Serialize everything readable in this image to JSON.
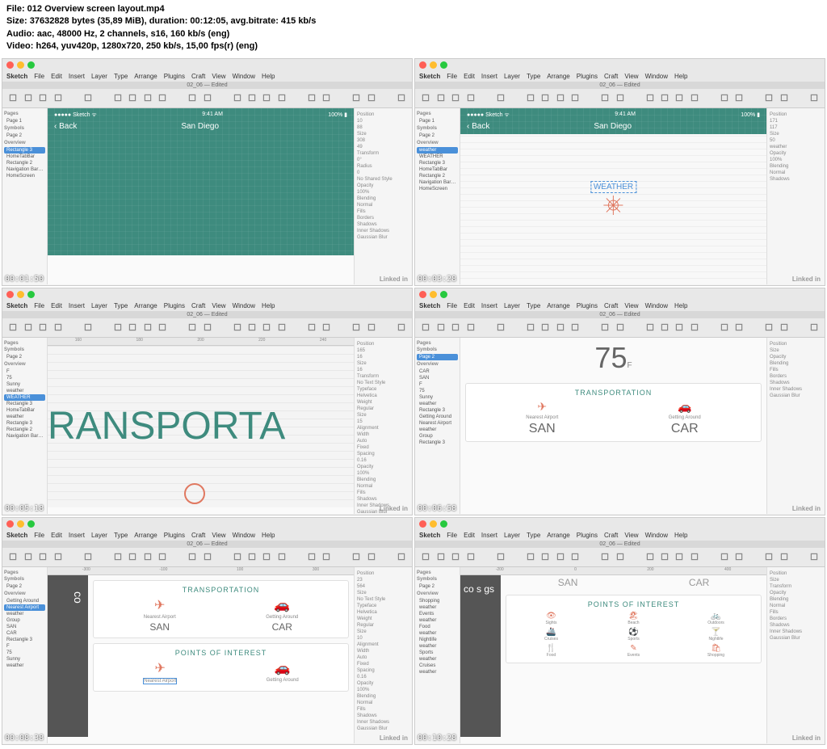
{
  "meta": {
    "file": "File: 012 Overview screen layout.mp4",
    "size": "Size: 37632828 bytes (35,89 MiB), duration: 00:12:05, avg.bitrate: 415 kb/s",
    "audio": "Audio: aac, 48000 Hz, 2 channels, s16, 160 kb/s (eng)",
    "video": "Video: h264, yuv420p, 1280x720, 250 kb/s, 15,00 fps(r) (eng)"
  },
  "menus": [
    "Sketch",
    "File",
    "Edit",
    "Insert",
    "Layer",
    "Type",
    "Arrange",
    "Plugins",
    "Craft",
    "View",
    "Window",
    "Help"
  ],
  "tabname": "02_06 — Edited",
  "linkedin": "Linked in",
  "phone": {
    "carrier": "Sketch",
    "time": "9:41 AM",
    "batt": "100%",
    "back": "Back",
    "title": "San Diego"
  },
  "tiles": [
    {
      "ts": "00:01:50",
      "left_sel": "Rectangle 3",
      "left": [
        "Pages",
        "Page 1",
        "Symbols",
        "Page 2",
        "Overview",
        "Rectangle 3",
        "HomeTabBar",
        "Rectangle 2",
        "Navigation Bar…",
        "HomeScreen"
      ],
      "right": [
        "Position",
        "10",
        "88",
        "Size",
        "308",
        "49",
        "Transform",
        "0°",
        "Radius",
        "0",
        "No Shared Style",
        "Opacity",
        "100%",
        "Blending",
        "Normal",
        "Fills",
        "Borders",
        "Shadows",
        "Inner Shadows",
        "Gaussian Blur"
      ]
    },
    {
      "ts": "00:03:28",
      "left_sel": "weather",
      "left": [
        "Pages",
        "Page 1",
        "Symbols",
        "Page 2",
        "Overview",
        "weather",
        "WEATHER",
        "Rectangle 3",
        "HomeTabBar",
        "Rectangle 2",
        "Navigation Bar…",
        "HomeScreen"
      ],
      "right": [
        "Position",
        "171",
        "117",
        "Size",
        "50",
        "weather",
        "Opacity",
        "100%",
        "Blending",
        "Normal",
        "Shadows"
      ],
      "weather_label": "WEATHER"
    },
    {
      "ts": "00:05:18",
      "left_sel": "WEATHER",
      "left": [
        "Pages",
        "Symbols",
        "Page 2",
        "Overview",
        "F",
        "75",
        "Sunny",
        "weather",
        "WEATHER",
        "Rectangle 3",
        "HomeTabBar",
        "weather",
        "Rectangle 3",
        "Rectangle 2",
        "Navigation Bar…"
      ],
      "right": [
        "Position",
        "165",
        "16",
        "Size",
        "16",
        "Transform",
        "No Text Style",
        "Typeface",
        "Helvetica",
        "Weight",
        "Regular",
        "Size",
        "15",
        "Alignment",
        "Width",
        "Auto",
        "Fixed",
        "Spacing",
        "0.16",
        "Opacity",
        "100%",
        "Blending",
        "Normal",
        "Fills",
        "Shadows",
        "Inner Shadows",
        "Gaussian Blur"
      ],
      "bigtext": "RANSPORTA",
      "ruler": [
        "160",
        "180",
        "200",
        "220",
        "240"
      ]
    },
    {
      "ts": "00:06:58",
      "left_sel": "Page 2",
      "left": [
        "Pages",
        "Symbols",
        "Page 2",
        "Overview",
        "CAR",
        "SAN",
        "F",
        "75",
        "Sunny",
        "weather",
        "Rectangle 3",
        "Getting Around",
        "Nearest Airport",
        "weather",
        "Group",
        "Rectangle 3"
      ],
      "right": [
        "Position",
        "Size",
        "Opacity",
        "Blending",
        "Fills",
        "Borders",
        "Shadows",
        "Inner Shadows",
        "Gaussian Blur"
      ],
      "temp": "75",
      "tempf": "F",
      "trans": {
        "title": "TRANSPORTATION",
        "a_sub": "Nearest Airport",
        "a_big": "SAN",
        "b_sub": "Getting Around",
        "b_big": "CAR"
      }
    },
    {
      "ts": "00:08:38",
      "left_sel": "Nearest Airport",
      "left": [
        "Pages",
        "Symbols",
        "Page 2",
        "Overview",
        "Getting Around",
        "Nearest Airport",
        "weather",
        "Group",
        "SAN",
        "CAR",
        "Rectangle 3",
        "F",
        "75",
        "Sunny",
        "weather"
      ],
      "right": [
        "Position",
        "23",
        "564",
        "Size",
        "No Text Style",
        "Typeface",
        "Helvetica",
        "Weight",
        "Regular",
        "Size",
        "10",
        "Alignment",
        "Width",
        "Auto",
        "Fixed",
        "Spacing",
        "0.16",
        "Opacity",
        "100%",
        "Blending",
        "Normal",
        "Fills",
        "Shadows",
        "Inner Shadows",
        "Gaussian Blur"
      ],
      "trans": {
        "title": "TRANSPORTATION",
        "a_sub": "Nearest Airport",
        "a_big": "SAN",
        "b_sub": "Getting Around",
        "b_big": "CAR"
      },
      "poi": {
        "title": "POINTS OF INTEREST",
        "a": "Nearest Airport",
        "b": "Getting Around"
      },
      "sidephoto": "co",
      "ruler": [
        "-300",
        "-100",
        "100",
        "300"
      ]
    },
    {
      "ts": "00:10:28",
      "left_sel": "",
      "left": [
        "Pages",
        "Symbols",
        "Page 2",
        "Overview",
        "Shopping",
        "weather",
        "Events",
        "weather",
        "Food",
        "weather",
        "Nightlife",
        "weather",
        "Sports",
        "weather",
        "Cruises",
        "weather"
      ],
      "right": [
        "Position",
        "Size",
        "Transform",
        "Opacity",
        "Blending",
        "Normal",
        "Fills",
        "Borders",
        "Shadows",
        "Inner Shadows",
        "Gaussian Blur"
      ],
      "topbig": {
        "a": "SAN",
        "b": "CAR"
      },
      "poi": {
        "title": "POINTS OF INTEREST",
        "items": [
          "Sights",
          "Beach",
          "Outdoors",
          "Cruises",
          "Sports",
          "Nightlife",
          "Food",
          "Events",
          "Shopping"
        ]
      },
      "sidephoto": "co s gs",
      "ruler": [
        "-200",
        "0",
        "200",
        "400"
      ]
    }
  ]
}
